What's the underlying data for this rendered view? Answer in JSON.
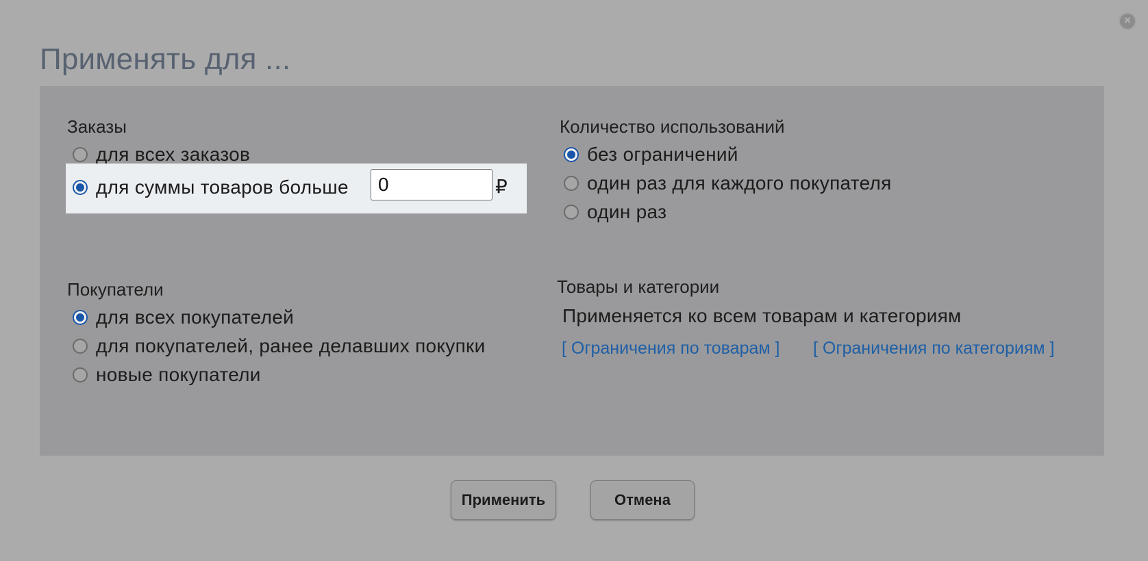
{
  "dialog": {
    "title": "Применять для ...",
    "close_icon": "close-icon"
  },
  "orders": {
    "label": "Заказы",
    "options": [
      {
        "label": "для всех заказов",
        "checked": false
      },
      {
        "label": "для суммы товаров больше",
        "checked": true
      }
    ],
    "amount_value": "0",
    "currency": "₽"
  },
  "usage": {
    "label": "Количество использований",
    "options": [
      {
        "label": "без ограничений",
        "checked": true
      },
      {
        "label": "один раз для каждого покупателя",
        "checked": false
      },
      {
        "label": "один раз",
        "checked": false
      }
    ]
  },
  "customers": {
    "label": "Покупатели",
    "options": [
      {
        "label": "для всех покупателей",
        "checked": true
      },
      {
        "label": "для покупателей, ранее делавших покупки",
        "checked": false
      },
      {
        "label": "новые покупатели",
        "checked": false
      }
    ]
  },
  "products": {
    "label": "Товары и категории",
    "info": "Применяется ко всем товарам и категориям",
    "link_products": "[ Ограничения по товарам ]",
    "link_categories": "[ Ограничения по категориям ]"
  },
  "buttons": {
    "apply": "Применить",
    "cancel": "Отмена"
  },
  "colors": {
    "overlay": "#ababab",
    "panel": "#9a9a9c",
    "accent": "#1a56a8",
    "link": "#1f5fa6",
    "title": "#586271"
  }
}
